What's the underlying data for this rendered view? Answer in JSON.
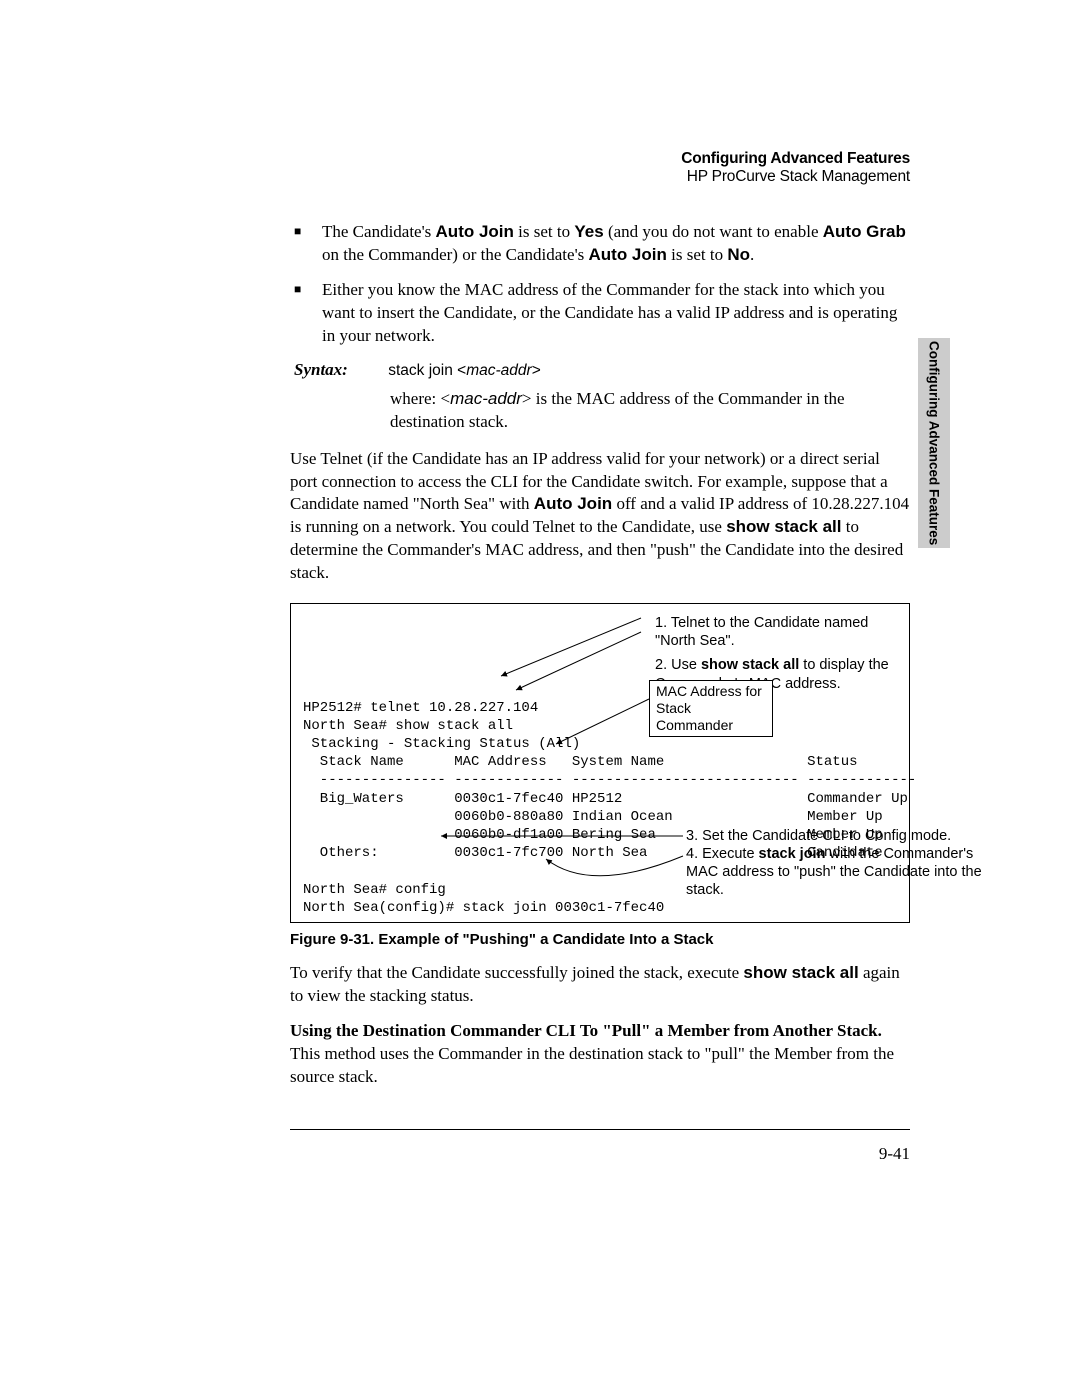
{
  "header": {
    "title": "Configuring Advanced Features",
    "subtitle": "HP ProCurve Stack Management"
  },
  "sidetab": "Configuring Advanced Features",
  "bullets": [
    {
      "pre": "The Candidate's ",
      "b1": "Auto Join",
      "mid": " is set to ",
      "b2": "Yes",
      "mid2": " (and  you do not want to enable ",
      "b3": "Auto Grab",
      "mid3": " on the Commander) or the Candidate's ",
      "b4": "Auto Join",
      "mid4": " is set to ",
      "b5": "No",
      "post": "."
    },
    {
      "text": "Either  you know the MAC address of the Commander for the stack into which you want to insert the Candidate, or the Candidate has a valid IP address and is operating in your network."
    }
  ],
  "syntax": {
    "label": "Syntax:",
    "cmd_pre": "stack join <",
    "cmd_arg": "mac-addr",
    "cmd_post": ">"
  },
  "where": {
    "pre": "where: <",
    "arg": "mac-addr",
    "post": "> is the MAC address of the Commander in the destination stack."
  },
  "para1": {
    "p1": "Use Telnet (if the Candidate has an IP address valid for your network) or a direct serial port connection to access the CLI for the Candidate switch. For example, suppose that a Candidate named \"North Sea\" with ",
    "b1": "Auto Join",
    "p2": " off and a valid IP address of 10.28.227.104 is running on a network. You could Telnet to the Candidate, use ",
    "b2": "show stack all",
    "p3": " to determine the Commander's MAC address, and then \"push\" the Candidate into the desired stack."
  },
  "figure": {
    "top1": "1.  Telnet to the Candidate named \"North Sea\".",
    "top2_pre": "2.  Use ",
    "top2_b": "show stack all",
    "top2_post": " to display the Commander's MAC address.",
    "callout_mac": "MAC Address for Stack Commander",
    "note3": "3.  Set the Candidate CLI to Config mode.",
    "note4_pre": "4.  Execute ",
    "note4_b": "stack join",
    "note4_post": " with the Commander's MAC address to \"push\" the Candidate into the stack.",
    "terminal": "HP2512# telnet 10.28.227.104\nNorth Sea# show stack all\n Stacking - Stacking Status (All)\n  Stack Name      MAC Address   System Name                 Status\n  --------------- ------------- --------------------------- -------------\n  Big_Waters      0030c1-7fec40 HP2512                      Commander Up\n                  0060b0-880a80 Indian Ocean                Member Up\n                  0060b0-df1a00 Bering Sea                  Member Up\n  Others:         0030c1-7fc700 North Sea                   Candidate\n\nNorth Sea# config\nNorth Sea(config)# stack join 0030c1-7fec40",
    "caption": "Figure 9-31.  Example of \"Pushing\" a Candidate Into a Stack"
  },
  "para2": {
    "p1": "To verify that the Candidate successfully joined the stack, execute ",
    "b1": "show stack all",
    "p2": " again to view the stacking status."
  },
  "para3": {
    "b1": "Using the Destination Commander CLI To \"Pull\" a Member from Another Stack.",
    "p1": "  This method uses the Commander in the destination stack to \"pull\" the Member from the source stack."
  },
  "pagenum": "9-41"
}
